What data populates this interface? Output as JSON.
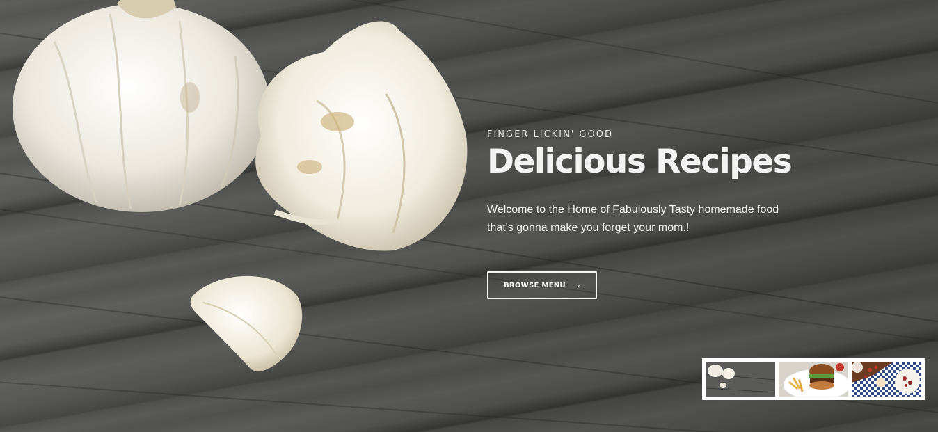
{
  "hero": {
    "eyebrow": "FINGER LICKIN' GOOD",
    "title": "Delicious Recipes",
    "description": "Welcome to the Home of Fabulously Tasty homemade food that's gonna make you forget your mom.!",
    "cta_label": "BROWSE MENU",
    "cta_icon": "chevron-right-icon",
    "background_image": "garlic-on-wooden-table",
    "colors": {
      "text": "#f2f2f2",
      "cta_border": "#ffffff",
      "thumb_frame": "#ffffff"
    }
  },
  "slider": {
    "thumbnails": [
      {
        "image": "garlic-on-wood",
        "active": true
      },
      {
        "image": "burger-and-fries",
        "active": false
      },
      {
        "image": "picnic-snacks",
        "active": false
      }
    ]
  }
}
